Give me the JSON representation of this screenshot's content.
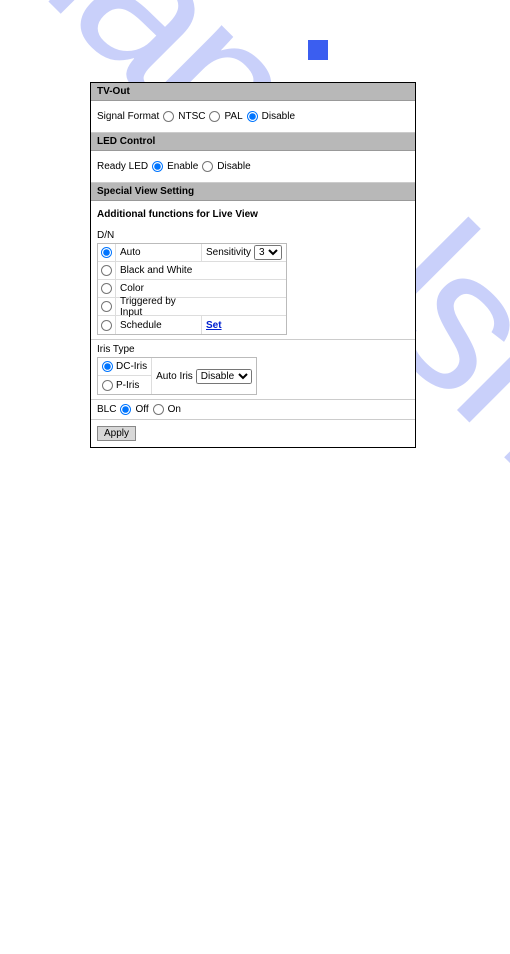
{
  "watermark": "manualshive.com",
  "sections": {
    "tvout": {
      "header": "TV-Out",
      "label": "Signal Format",
      "options": {
        "ntsc": "NTSC",
        "pal": "PAL",
        "disable": "Disable"
      },
      "selected": "disable"
    },
    "led": {
      "header": "LED Control",
      "label": "Ready LED",
      "options": {
        "enable": "Enable",
        "disable": "Disable"
      },
      "selected": "enable"
    },
    "special": {
      "header": "Special View Setting",
      "subhead": "Additional functions for Live View",
      "dn": {
        "label": "D/N",
        "rows": {
          "auto": {
            "label": "Auto"
          },
          "bw": {
            "label": "Black and White"
          },
          "color": {
            "label": "Color"
          },
          "triggered": {
            "label": "Triggered by Input"
          },
          "schedule": {
            "label": "Schedule",
            "link": "Set"
          }
        },
        "sensitivity_label": "Sensitivity",
        "sensitivity_value": "3",
        "selected": "auto"
      },
      "iris": {
        "label": "Iris Type",
        "options": {
          "dc": "DC-Iris",
          "p": "P-Iris"
        },
        "auto_label": "Auto Iris",
        "auto_value": "Disable",
        "selected": "dc"
      },
      "blc": {
        "label": "BLC",
        "options": {
          "off": "Off",
          "on": "On"
        },
        "selected": "off"
      }
    },
    "apply": "Apply"
  }
}
